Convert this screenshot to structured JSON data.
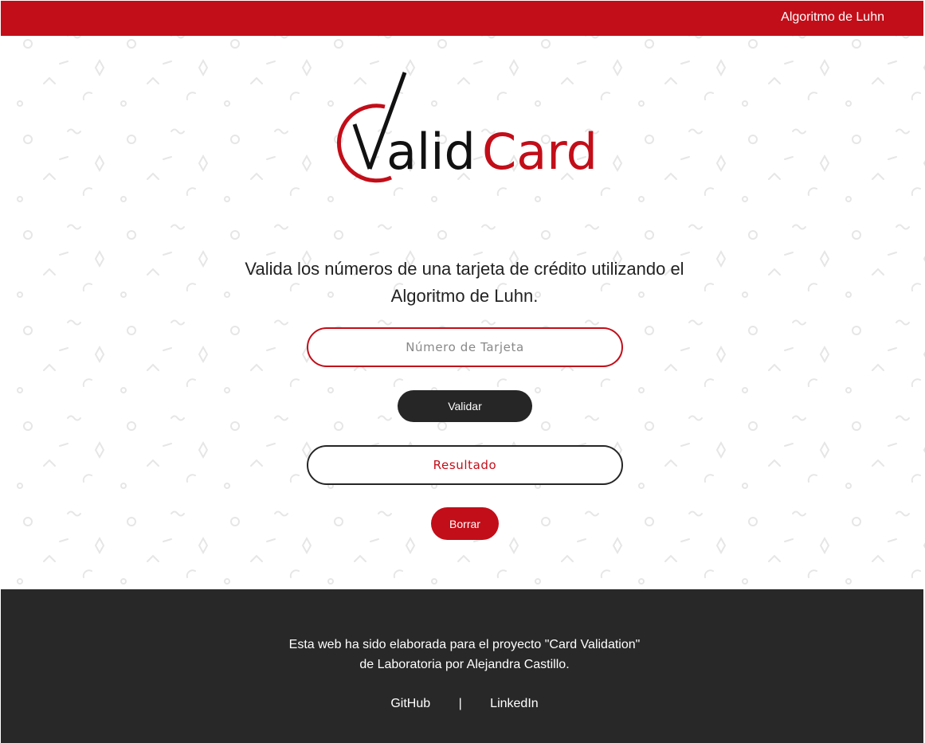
{
  "header": {
    "nav_link": "Algoritmo de Luhn"
  },
  "logo": {
    "text_valid": "alid",
    "text_card": "Card",
    "mark": "V"
  },
  "main": {
    "subtitle_line1": "Valida los números de una tarjeta de crédito utilizando el",
    "subtitle_line2": "Algoritmo de Luhn.",
    "card_input": {
      "placeholder": "Número de Tarjeta",
      "value": ""
    },
    "validate_button": "Validar",
    "result_text": "Resultado",
    "clear_button": "Borrar"
  },
  "footer": {
    "credit_line1": "Esta web ha sido elaborada para el proyecto \"Card Validation\"",
    "credit_line2": "de Laboratoria por Alejandra Castillo.",
    "link_github": "GitHub",
    "separator": "|",
    "link_linkedin": "LinkedIn"
  },
  "colors": {
    "brand_red": "#c20e19",
    "dark": "#262626",
    "footer_bg": "#282828",
    "pattern": "#e6e6e6"
  }
}
